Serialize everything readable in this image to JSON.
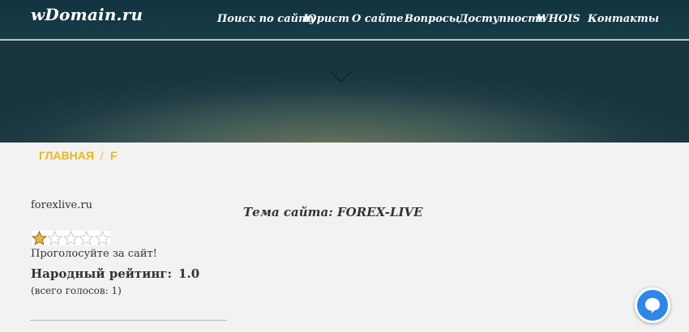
{
  "header": {
    "logo": "wDomain.ru",
    "nav": [
      {
        "label": "Поиск по сайту"
      },
      {
        "label": "Юрист"
      },
      {
        "label": "О сайте"
      },
      {
        "label": "Вопросы"
      },
      {
        "label": "Доступность"
      },
      {
        "label": "WHOIS"
      },
      {
        "label": "Контакты"
      }
    ],
    "accent_color": "#b8a13a"
  },
  "hero": {
    "icon": "chevron-down-icon"
  },
  "breadcrumb": {
    "home": "ГЛАВНАЯ",
    "separator": "/",
    "current": "F",
    "color": "#e8b71d"
  },
  "sidebar": {
    "site_name": "forexlive.ru",
    "stars": {
      "total": 5,
      "filled": 1
    },
    "vote_prompt": "Проголосуйте за сайт!",
    "rating_label": "Народный рейтинг:",
    "rating_value": "1.0",
    "votes_text": "(всего голосов: 1)"
  },
  "main": {
    "theme": "Тема сайта: FOREX-LIVE"
  },
  "chat": {
    "icon": "chat-bubble-icon",
    "color": "#2f86e6"
  }
}
